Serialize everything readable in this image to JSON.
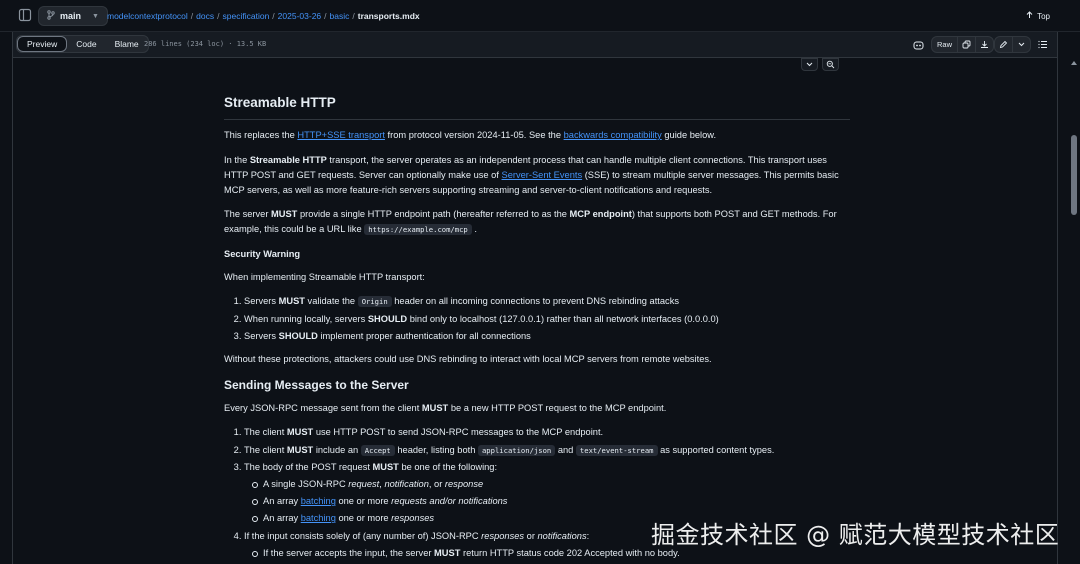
{
  "header": {
    "branch": "main",
    "breadcrumb": [
      "modelcontextprotocol",
      "docs",
      "specification",
      "2025-03-26",
      "basic"
    ],
    "current_file": "transports.mdx",
    "top_label": "Top"
  },
  "toolbar": {
    "tabs": [
      "Preview",
      "Code",
      "Blame"
    ],
    "file_meta": "286 lines (234 loc) · 13.5 KB",
    "raw_label": "Raw"
  },
  "article": {
    "h_streamable": "Streamable HTTP",
    "p1": {
      "a": "This replaces the ",
      "link1": "HTTP+SSE transport",
      "b": " from protocol version 2024-11-05. See the ",
      "link2": "backwards compatibility",
      "c": " guide below."
    },
    "p2": {
      "a": "In the ",
      "bold": "Streamable HTTP",
      "b": " transport, the server operates as an independent process that can handle multiple client connections. This transport uses HTTP POST and GET requests. Server can optionally make use of ",
      "link": "Server-Sent Events",
      "c": " (SSE) to stream multiple server messages. This permits basic MCP servers, as well as more feature-rich servers supporting streaming and server-to-client notifications and requests."
    },
    "p3": {
      "a": "The server ",
      "must": "MUST",
      "b": " provide a single HTTP endpoint path (hereafter referred to as the ",
      "bold": "MCP endpoint",
      "c": ") that supports both POST and GET methods. For example, this could be a URL like ",
      "code": "https://example.com/mcp",
      "d": " ."
    },
    "h_security": "Security Warning",
    "p_security": "When implementing Streamable HTTP transport:",
    "security_list": [
      {
        "a": "Servers ",
        "b": "MUST",
        "c": " validate the ",
        "code": "Origin",
        "d": " header on all incoming connections to prevent DNS rebinding attacks"
      },
      {
        "a": "When running locally, servers ",
        "b": "SHOULD",
        "c": " bind only to localhost (127.0.0.1) rather than all network interfaces (0.0.0.0)"
      },
      {
        "a": "Servers ",
        "b": "SHOULD",
        "c": " implement proper authentication for all connections"
      }
    ],
    "p_without": "Without these protections, attackers could use DNS rebinding to interact with local MCP servers from remote websites.",
    "h_sending": "Sending Messages to the Server",
    "p_every": {
      "a": "Every JSON-RPC message sent from the client ",
      "b": "MUST",
      "c": " be a new HTTP POST request to the MCP endpoint."
    },
    "send_list": {
      "item1": {
        "a": "The client ",
        "b": "MUST",
        "c": " use HTTP POST to send JSON-RPC messages to the MCP endpoint."
      },
      "item2": {
        "a": "The client ",
        "b": "MUST",
        "c": " include an ",
        "code1": "Accept",
        "d": " header, listing both ",
        "code2": "application/json",
        "e": " and ",
        "code3": "text/event-stream",
        "f": " as supported content types."
      },
      "item3": {
        "a": "The body of the POST request ",
        "b": "MUST",
        "c": " be one of the following:"
      },
      "sub1": {
        "a": "A single JSON-RPC ",
        "i1": "request",
        "b": ", ",
        "i2": "notification",
        "c": ", or ",
        "i3": "response"
      },
      "sub2": {
        "a": "An array ",
        "link": "batching",
        "b": " one or more ",
        "i": "requests and/or notifications"
      },
      "sub3": {
        "a": "An array ",
        "link": "batching",
        "b": " one or more ",
        "i": "responses"
      },
      "item4": {
        "a": "If the input consists solely of (any number of) JSON-RPC ",
        "i1": "responses",
        "b": " or ",
        "i2": "notifications",
        "c": ":"
      },
      "sub4": {
        "a": "If the server accepts the input, the server ",
        "b": "MUST",
        "c": " return HTTP status code 202 Accepted with no body."
      }
    }
  },
  "watermark": "掘金技术社区 @ 赋范大模型技术社区",
  "icons": [
    "sidebar-toggle-icon",
    "git-branch-icon",
    "arrow-up-icon",
    "copilot-icon",
    "copy-icon",
    "download-icon",
    "pencil-icon",
    "list-icon",
    "chevron-down-icon",
    "zoom-icon"
  ],
  "colors": {
    "background": "#0d1117",
    "link": "#4493f8",
    "text": "#e6edf3",
    "muted": "#8b949e",
    "border": "#30363d"
  }
}
